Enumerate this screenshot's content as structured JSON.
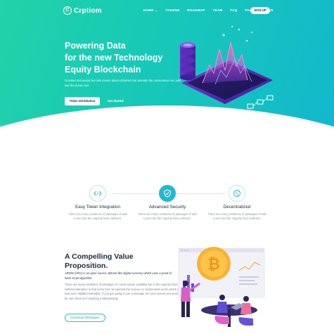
{
  "colors": {
    "primary_start": "#20d3a8",
    "primary_end": "#12b7cf",
    "accent": "#22b8cf",
    "dark": "#1b2a3a"
  },
  "nav": {
    "logo_letter": "C",
    "logo_text": "Crptiom",
    "items": [
      {
        "label": "HOME",
        "dropdown": true
      },
      {
        "label": "TOKENS",
        "dropdown": false
      },
      {
        "label": "ROADMAP",
        "dropdown": false
      },
      {
        "label": "TEAM",
        "dropdown": false
      },
      {
        "label": "FAQ",
        "dropdown": false
      },
      {
        "label": "PAGES",
        "dropdown": true
      },
      {
        "label": "EN",
        "dropdown": false
      }
    ],
    "signup_label": "SIGN UP"
  },
  "hero": {
    "title": "Powering Data\nfor the new Technology\nEquity Blockchain",
    "subtitle": "Gravitas mat suada faci des conem ipsum dolomet mar ametian the consectetur nec adis see the dumm text",
    "primary_button": "Token Distribution",
    "secondary_button": "Get Started"
  },
  "features": [
    {
      "icon": "code-icon",
      "title": "Easy Token Integration",
      "desc": "There are many variations of passages of add Lorem but the majority have suffered."
    },
    {
      "icon": "shield-icon",
      "title": "Advanced Security",
      "desc": "There are many variations of passages of add Lorem but the majority have suffered."
    },
    {
      "icon": "globe-icon",
      "title": "Decentralized",
      "desc": "There are many variations of passages of add Lorem but the majority have suffered."
    }
  ],
  "value": {
    "title": "A Compelling Value Proposition.",
    "italic": "ARDM (ARC) is an open source, Bitcoin-like digital currency which uses a proof of work script algorithm.",
    "body": "There are many variations of passages of Lorem Ipsum available but is the majority have suffered alteration in that some form by injected the humour or randomised words which don't look even slightly believable. If you are going to use a passage of Lorem Ipsum you need to be sure there isn't anything embarrassing.",
    "button": "Download Whitepaper"
  }
}
